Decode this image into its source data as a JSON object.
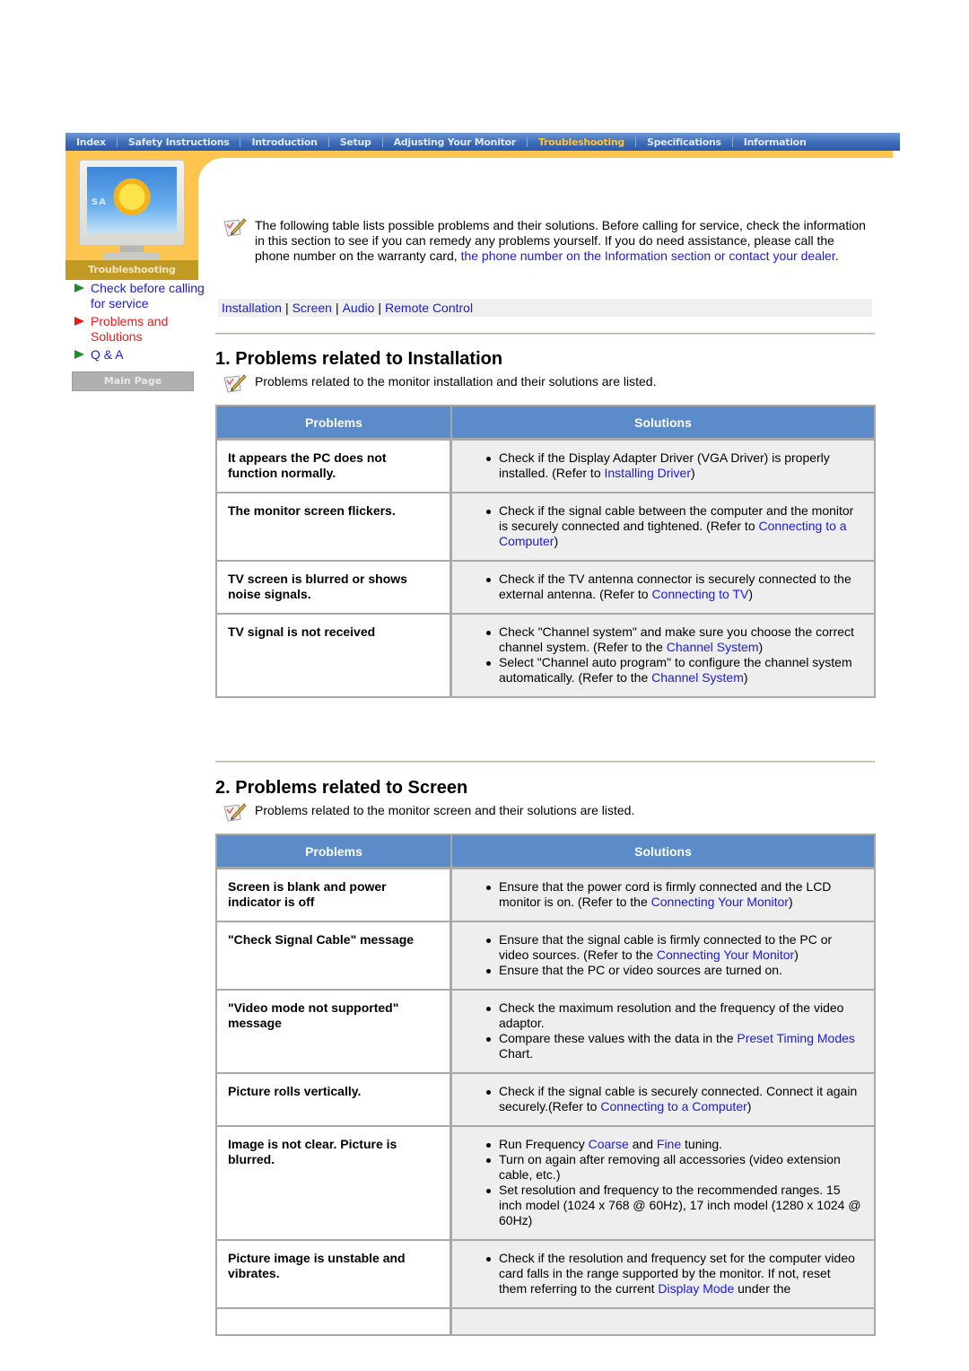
{
  "topnav": {
    "items": [
      {
        "label": "Index",
        "active": false
      },
      {
        "label": "Safety Instructions",
        "active": false
      },
      {
        "label": "Introduction",
        "active": false
      },
      {
        "label": "Setup",
        "active": false
      },
      {
        "label": "Adjusting Your Monitor",
        "active": false
      },
      {
        "label": "Troubleshooting",
        "active": true
      },
      {
        "label": "Specifications",
        "active": false
      },
      {
        "label": "Information",
        "active": false
      }
    ],
    "active_color": "#ffc437"
  },
  "sidebar": {
    "monitor_brand": "SA",
    "section_label": "Troubleshooting",
    "items": [
      {
        "label": "Check before calling for service",
        "active": false
      },
      {
        "label": "Problems and Solutions",
        "active": true
      },
      {
        "label": "Q & A",
        "active": false
      }
    ],
    "main_page_button": "Main Page"
  },
  "intro": {
    "text": "The following table lists possible problems and their solutions. Before calling for service, check the information in this section to see if you can remedy any problems yourself. If you do need assistance, please call the phone number on the warranty card, ",
    "link": "the phone number on the Information section or contact your dealer",
    "suffix": "."
  },
  "subnav": {
    "links": [
      "Installation",
      "Screen",
      "Audio",
      "Remote Control"
    ]
  },
  "sections": [
    {
      "title": "1. Problems related to Installation",
      "note": "Problems related to the monitor installation and their solutions are listed.",
      "headers": {
        "problems": "Problems",
        "solutions": "Solutions"
      },
      "rows": [
        {
          "problem": "It appears the PC does not function normally.",
          "solutions": [
            [
              {
                "t": "Check if the Display Adapter Driver (VGA Driver) is properly installed. (Refer to "
              },
              {
                "l": "Installing Driver"
              },
              {
                "t": ")"
              }
            ]
          ]
        },
        {
          "problem": "The monitor screen flickers.",
          "solutions": [
            [
              {
                "t": "Check if the signal cable between the computer and the monitor is securely connected and tightened. (Refer to "
              },
              {
                "l": "Connecting to a Computer"
              },
              {
                "t": ")"
              }
            ]
          ]
        },
        {
          "problem": "TV screen is blurred or shows noise signals.",
          "solutions": [
            [
              {
                "t": "Check if the TV antenna connector is securely connected to the external antenna. (Refer to "
              },
              {
                "l": "Connecting to TV"
              },
              {
                "t": ")"
              }
            ]
          ]
        },
        {
          "problem": "TV signal is not received",
          "solutions": [
            [
              {
                "t": "Check \"Channel system\" and make sure you choose the correct channel system. (Refer to the "
              },
              {
                "l": "Channel System"
              },
              {
                "t": ")"
              }
            ],
            [
              {
                "t": "Select \"Channel auto program\" to configure the channel system automatically. (Refer to the "
              },
              {
                "l": "Channel System"
              },
              {
                "t": ")"
              }
            ]
          ]
        }
      ]
    },
    {
      "title": "2. Problems related to Screen",
      "note": "Problems related to the monitor screen and their solutions are listed.",
      "headers": {
        "problems": "Problems",
        "solutions": "Solutions"
      },
      "rows": [
        {
          "problem": "Screen is blank and power indicator is off",
          "solutions": [
            [
              {
                "t": "Ensure that the power cord is firmly connected and the LCD monitor is on. (Refer to the "
              },
              {
                "l": "Connecting Your Monitor"
              },
              {
                "t": ")"
              }
            ]
          ]
        },
        {
          "problem": "\"Check Signal Cable\" message",
          "solutions": [
            [
              {
                "t": "Ensure that the signal cable is firmly connected to the PC or video sources. (Refer to the "
              },
              {
                "l": "Connecting Your Monitor"
              },
              {
                "t": ")"
              }
            ],
            [
              {
                "t": "Ensure that the PC or video sources are turned on."
              }
            ]
          ]
        },
        {
          "problem": "\"Video mode not supported\" message",
          "solutions": [
            [
              {
                "t": "Check the maximum resolution and the frequency of the video adaptor."
              }
            ],
            [
              {
                "t": "Compare these values with the data in the "
              },
              {
                "l": "Preset Timing Modes"
              },
              {
                "t": " Chart."
              }
            ]
          ]
        },
        {
          "problem": "Picture rolls vertically.",
          "solutions": [
            [
              {
                "t": "Check if the signal cable is securely connected. Connect it again securely.(Refer to "
              },
              {
                "l": "Connecting to a Computer"
              },
              {
                "t": ")"
              }
            ]
          ]
        },
        {
          "problem": "Image is not clear. Picture is blurred.",
          "solutions": [
            [
              {
                "t": "Run Frequency "
              },
              {
                "l": "Coarse"
              },
              {
                "t": " and "
              },
              {
                "l": "Fine"
              },
              {
                "t": " tuning."
              }
            ],
            [
              {
                "t": "Turn on again after removing all accessories (video extension cable, etc.)"
              }
            ],
            [
              {
                "t": "Set resolution and frequency to the recommended ranges. 15 inch model (1024 x 768 @ 60Hz), 17 inch model (1280 x 1024 @ 60Hz)"
              }
            ]
          ]
        },
        {
          "problem": "Picture image is unstable and vibrates.",
          "solutions": [
            [
              {
                "t": "Check if the resolution and frequency set for the computer video card falls in the range supported by the monitor. If not, reset them referring to the current "
              },
              {
                "l": "Display Mode"
              },
              {
                "t": " under the"
              }
            ]
          ]
        }
      ]
    }
  ]
}
